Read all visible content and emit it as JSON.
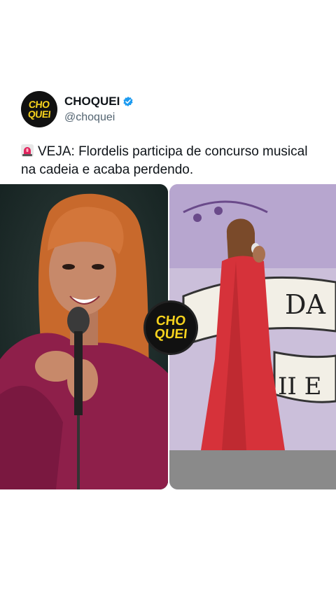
{
  "account": {
    "avatar_line1": "CHO",
    "avatar_line2": "QUEI",
    "display_name": "CHOQUEI",
    "handle": "@choquei",
    "verified": true
  },
  "tweet": {
    "text": "VEJA: Flordelis participa de concurso musical na cadeia e acaba perdendo.",
    "leading_icon": "siren-icon"
  },
  "media": {
    "badge_line1": "CHO",
    "badge_line2": "QUEI",
    "left_image": "woman with orange hair singing into microphone",
    "right_image": "woman in red dress singing on stage"
  },
  "colors": {
    "brand_yellow": "#f6d21d",
    "verified_blue": "#1d9bf0",
    "text_primary": "#0f1419",
    "text_secondary": "#536471"
  }
}
